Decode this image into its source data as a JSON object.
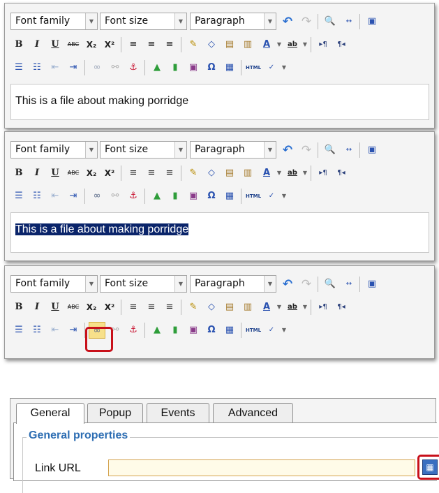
{
  "toolbar": {
    "font_family": "Font family",
    "font_size": "Font size",
    "format": "Paragraph",
    "html_label": "HTML",
    "abc_label": "ABC",
    "buttons": {
      "bold": "B",
      "italic": "I",
      "underline": "U",
      "strike": "ABC",
      "subscript": "X₂",
      "superscript": "X²",
      "omega": "Ω"
    }
  },
  "editor": {
    "content_text": "This is a file about making porridge"
  },
  "dialog": {
    "tabs": [
      "General",
      "Popup",
      "Events",
      "Advanced"
    ],
    "active_tab": "General",
    "section_title": "General properties",
    "link_url_label": "Link URL",
    "link_url_value": ""
  },
  "colors": {
    "highlight": "#c8101a",
    "selection": "#0a246a",
    "section_title": "#2e6eb3"
  },
  "icons": [
    "undo-icon",
    "redo-icon",
    "find-icon",
    "replace-icon",
    "fullscreen-icon",
    "bold-icon",
    "italic-icon",
    "underline-icon",
    "strikethrough-icon",
    "subscript-icon",
    "superscript-icon",
    "align-left-icon",
    "align-center-icon",
    "align-right-icon",
    "cleanup-icon",
    "eraser-icon",
    "paste-text-icon",
    "paste-word-icon",
    "forecolor-icon",
    "backcolor-icon",
    "ltr-icon",
    "rtl-icon",
    "bullet-list-icon",
    "numbered-list-icon",
    "outdent-icon",
    "indent-icon",
    "link-icon",
    "unlink-icon",
    "anchor-icon",
    "image-icon",
    "media-icon",
    "insert-icon",
    "charmap-icon",
    "template-icon",
    "html-icon",
    "spellcheck-icon",
    "browse-icon"
  ]
}
